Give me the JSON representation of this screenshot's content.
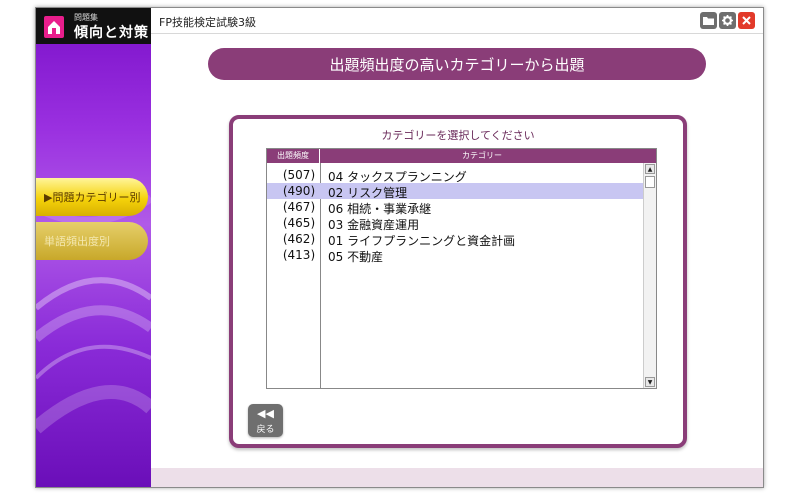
{
  "app": {
    "logo_sub": "問題集",
    "logo_main": "傾向と対策",
    "title": "FP技能検定試験3級"
  },
  "sidebar": {
    "items": [
      {
        "label": "▶問題カテゴリー別",
        "active": true
      },
      {
        "label": "単語頻出度別",
        "active": false
      }
    ]
  },
  "header": {
    "title": "出題頻出度の高いカテゴリーから出題"
  },
  "panel": {
    "title": "カテゴリーを選択してください",
    "columns": {
      "frequency": "出題頻度",
      "category": "カテゴリー"
    },
    "rows": [
      {
        "freq": "(507)",
        "cat": "04 タックスプランニング",
        "selected": false
      },
      {
        "freq": "(490)",
        "cat": "02 リスク管理",
        "selected": true
      },
      {
        "freq": "(467)",
        "cat": "06 相続・事業承継",
        "selected": false
      },
      {
        "freq": "(465)",
        "cat": "03 金融資産運用",
        "selected": false
      },
      {
        "freq": "(462)",
        "cat": "01 ライフプランニングと資金計画",
        "selected": false
      },
      {
        "freq": "(413)",
        "cat": "05 不動産",
        "selected": false
      }
    ]
  },
  "back_button": {
    "icon": "◀◀",
    "label": "戻る"
  },
  "colors": {
    "accent": "#8a3d78",
    "selection": "#c8c6f2",
    "sidebar_active": "#f5d20a",
    "close": "#e23a2a"
  }
}
